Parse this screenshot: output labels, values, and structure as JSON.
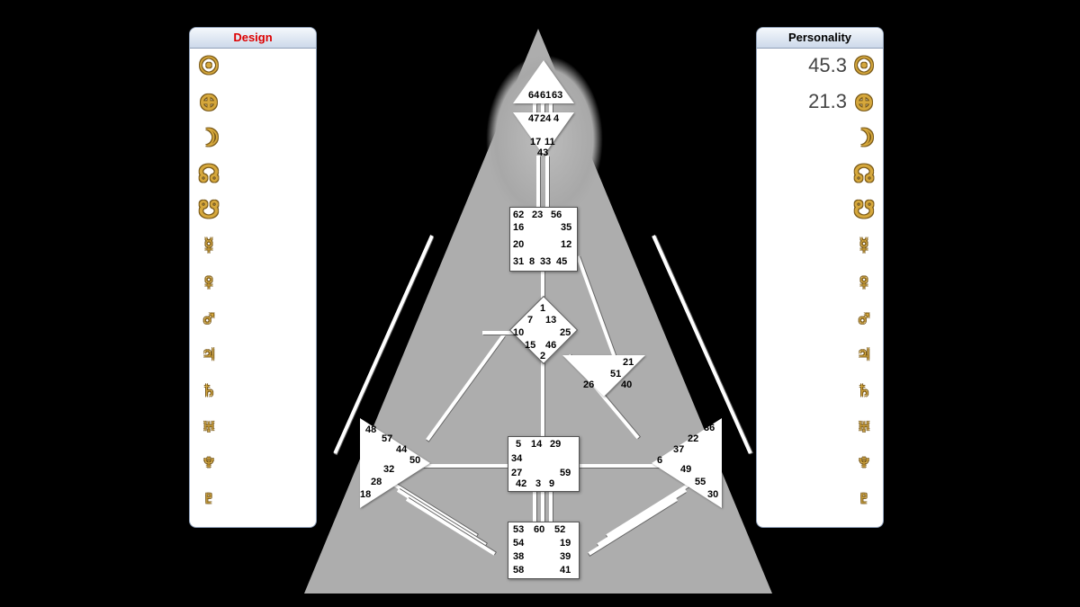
{
  "panels": {
    "design": {
      "title": "Design",
      "values": [
        "",
        "",
        "",
        "",
        "",
        "",
        "",
        "",
        "",
        "",
        "",
        "",
        ""
      ]
    },
    "personality": {
      "title": "Personality",
      "values": [
        "45.3",
        "21.3",
        "",
        "",
        "",
        "",
        "",
        "",
        "",
        "",
        "",
        "",
        ""
      ]
    }
  },
  "glyphs": [
    "☉",
    "⊕",
    "☽",
    "☊",
    "☋",
    "☿",
    "♀",
    "♂",
    "♃",
    "♄",
    "♅",
    "♆",
    "♇"
  ],
  "centers": {
    "head": {
      "gates": [
        "64",
        "61",
        "63"
      ]
    },
    "ajna": {
      "gates": [
        "47",
        "24",
        "4",
        "17",
        "11",
        "43"
      ]
    },
    "throat": {
      "gates": [
        "62",
        "23",
        "56",
        "16",
        "35",
        "20",
        "12",
        "31",
        "8",
        "33",
        "45"
      ]
    },
    "g": {
      "gates": [
        "1",
        "7",
        "13",
        "10",
        "25",
        "15",
        "46",
        "2"
      ]
    },
    "heart": {
      "gates": [
        "21",
        "51",
        "26",
        "40"
      ]
    },
    "spleen": {
      "gates": [
        "48",
        "57",
        "44",
        "50",
        "32",
        "28",
        "18"
      ]
    },
    "solar": {
      "gates": [
        "36",
        "22",
        "37",
        "6",
        "49",
        "55",
        "30"
      ]
    },
    "sacral": {
      "gates": [
        "5",
        "14",
        "29",
        "34",
        "27",
        "59",
        "42",
        "3",
        "9"
      ]
    },
    "root": {
      "gates": [
        "53",
        "60",
        "52",
        "54",
        "19",
        "38",
        "39",
        "58",
        "41"
      ]
    }
  }
}
